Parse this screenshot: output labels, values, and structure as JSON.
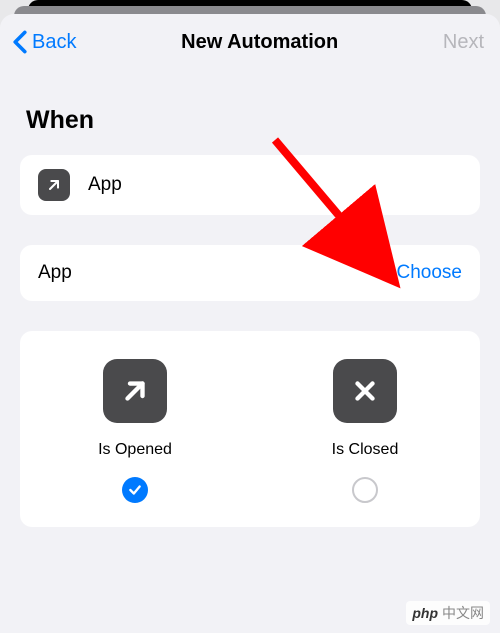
{
  "nav": {
    "back_label": "Back",
    "title": "New Automation",
    "next_label": "Next"
  },
  "section": {
    "title": "When"
  },
  "trigger": {
    "label": "App"
  },
  "app_row": {
    "label": "App",
    "choose_label": "Choose"
  },
  "options": {
    "opened": {
      "label": "Is Opened",
      "selected": true
    },
    "closed": {
      "label": "Is Closed",
      "selected": false
    }
  },
  "watermark": {
    "brand": "php",
    "text": "中文网"
  }
}
